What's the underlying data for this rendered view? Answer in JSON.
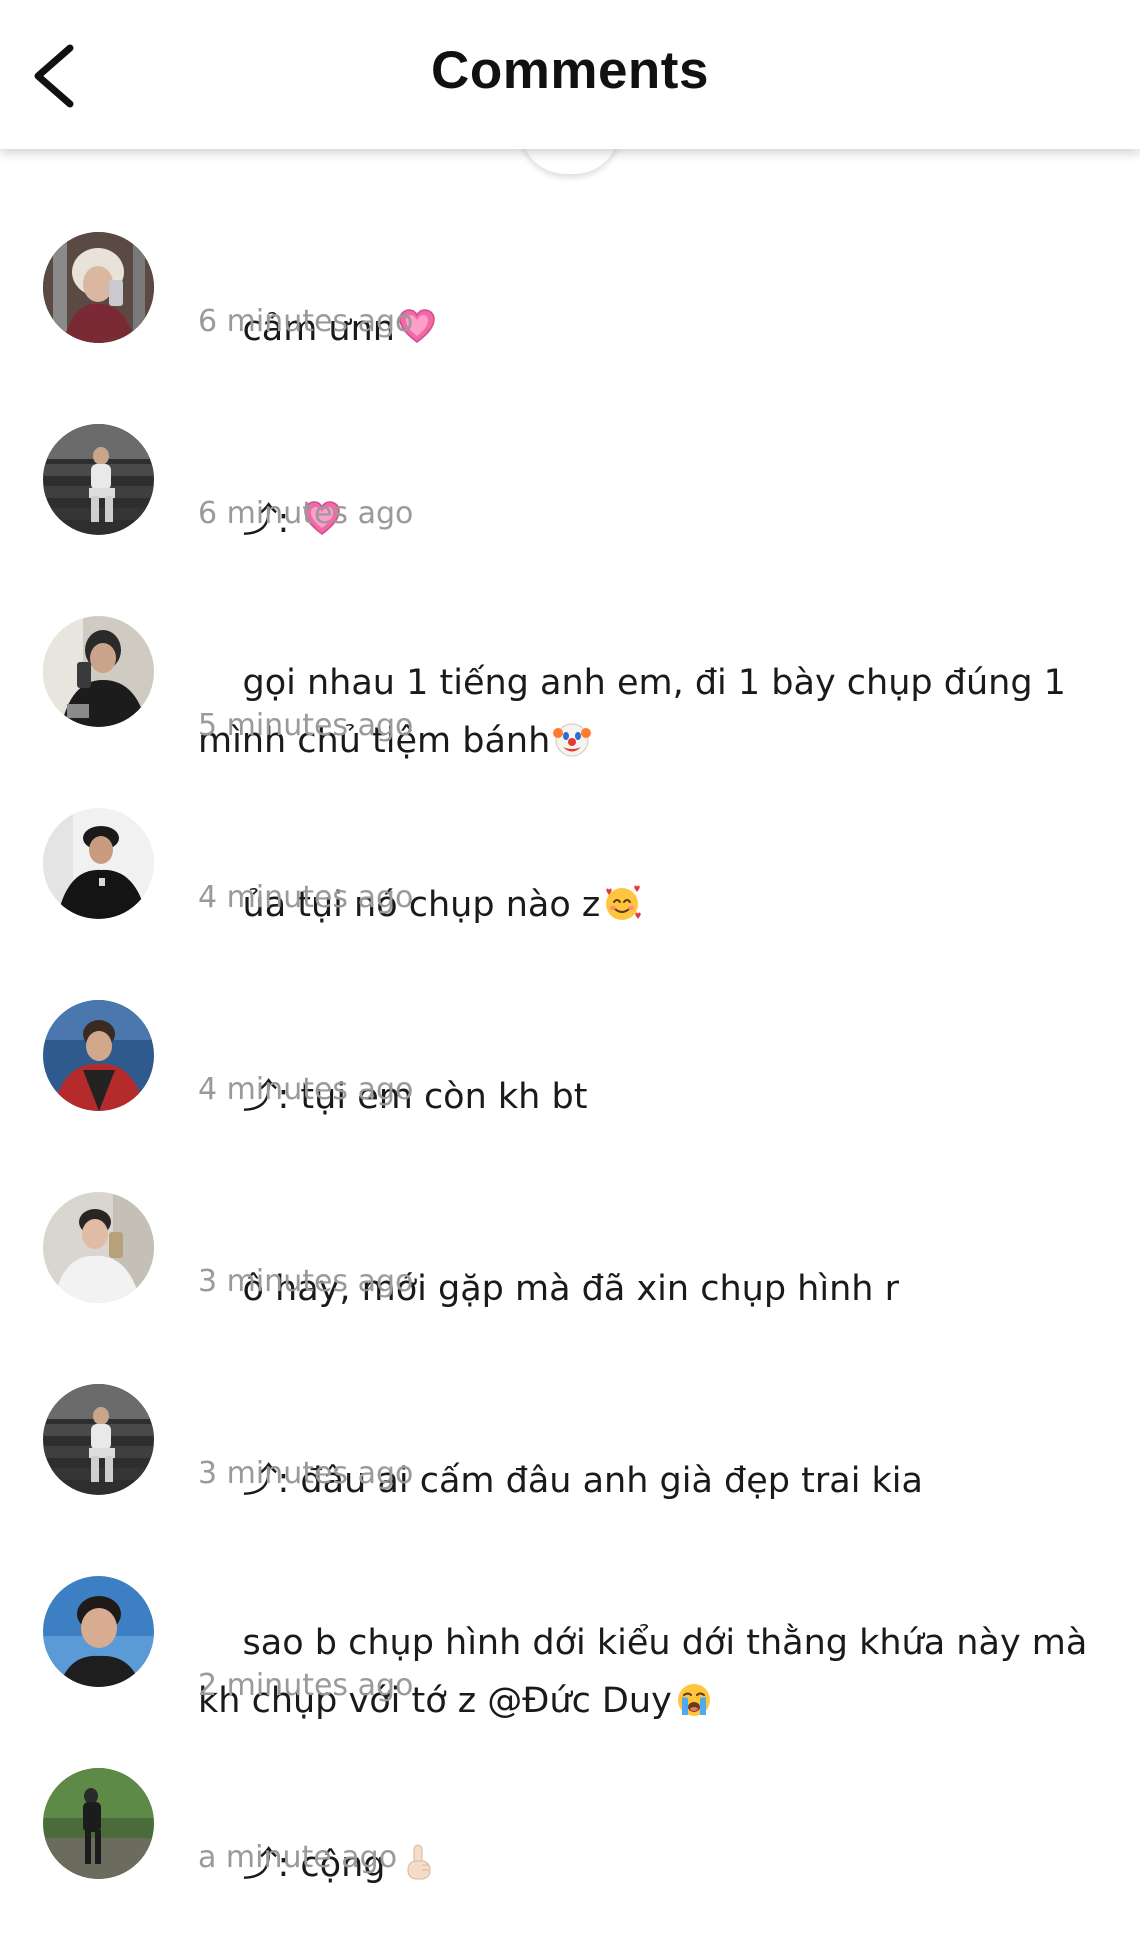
{
  "header": {
    "title": "Comments",
    "back_icon": "chevron-left-icon"
  },
  "comments": [
    {
      "text": "cảm ưnn",
      "emoji": "pink-heart-icon",
      "time": "6 minutes ago"
    },
    {
      "text": "⤴: ",
      "emoji": "pink-heart-icon",
      "time": "6 minutes ago"
    },
    {
      "text": "gọi nhau 1 tiếng anh em, đi 1 bày chụp đúng 1 mình chủ tiệm bánh",
      "emoji": "clown-face-icon",
      "time": "5 minutes ago"
    },
    {
      "text": "ủa tụi nó chụp nào z",
      "emoji": "smiling-face-with-hearts-icon",
      "time": "4 minutes ago"
    },
    {
      "text": "⤴: tụi em còn kh bt",
      "emoji": "",
      "time": "4 minutes ago"
    },
    {
      "text": "ô hay, mới gặp mà đã xin chụp hình r",
      "emoji": "",
      "time": "3 minutes ago"
    },
    {
      "text": "⤴: đâu ai cấm đâu anh già đẹp trai kia",
      "emoji": "",
      "time": "3 minutes ago"
    },
    {
      "text": "sao b chụp hình dới kiểu dới thằng khứa này mà kh chụp với tớ z @Đức Duy",
      "emoji": "loudly-crying-face-icon",
      "time": "2 minutes ago"
    },
    {
      "text": "⤴: cộng ",
      "emoji": "index-pointing-up-icon",
      "time": "a minute ago"
    }
  ],
  "colors": {
    "text": "#1a1a1a",
    "timestamp": "#9a9a9a",
    "background": "#ffffff"
  }
}
